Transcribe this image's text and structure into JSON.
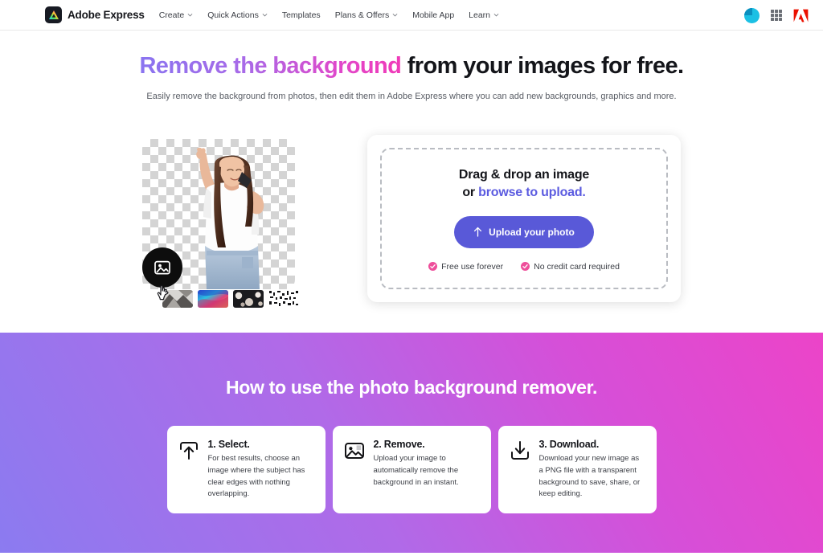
{
  "colors": {
    "accent_purple": "#5959d8",
    "link_purple": "#5b5be0",
    "pink_check": "#ee4f9b",
    "adobe_red": "#eb1000",
    "avatar_cyan": "#1bc0e4",
    "gradient_start": "#8b7bf0",
    "gradient_end": "#ec44c8"
  },
  "nav": {
    "brand": "Adobe Express",
    "brand_icon": "adobe-express-logo-icon",
    "links": [
      {
        "label": "Create",
        "has_caret": true
      },
      {
        "label": "Quick Actions",
        "has_caret": true
      },
      {
        "label": "Templates",
        "has_caret": false
      },
      {
        "label": "Plans & Offers",
        "has_caret": true
      },
      {
        "label": "Mobile App",
        "has_caret": false
      },
      {
        "label": "Learn",
        "has_caret": true
      }
    ],
    "right_icons": [
      "user-avatar",
      "apps-grid-icon",
      "adobe-logo-icon"
    ]
  },
  "hero": {
    "headline_gradient": "Remove the background",
    "headline_rest": " from your images for free.",
    "subheadline": "Easily remove the background from photos, then edit them in Adobe Express where you can add new backgrounds, graphics and more."
  },
  "preview": {
    "subject_alt": "woman-with-removed-background",
    "circle_button_icon": "image-icon",
    "cursor_icon": "hand-cursor-icon",
    "thumbnails": [
      {
        "name": "grayscale-geometric-background"
      },
      {
        "name": "colorful-abstract-background"
      },
      {
        "name": "dark-floral-background"
      },
      {
        "name": "black-white-noise-background"
      }
    ]
  },
  "upload": {
    "drop_line1": "Drag & drop an image",
    "drop_line2_prefix": "or ",
    "drop_line2_link": "browse to upload.",
    "button_label": "Upload your photo",
    "button_icon": "upload-arrow-icon",
    "perks": [
      {
        "label": "Free use forever",
        "icon": "check-circle-icon"
      },
      {
        "label": "No credit card required",
        "icon": "check-circle-icon"
      }
    ]
  },
  "howto": {
    "title": "How to use the photo background remover.",
    "steps": [
      {
        "icon": "upload-box-icon",
        "title": "1. Select.",
        "desc": "For best results, choose an image where the subject has clear edges with nothing overlapping."
      },
      {
        "icon": "image-icon",
        "title": "2. Remove.",
        "desc": "Upload your image to automatically remove the background in an instant."
      },
      {
        "icon": "download-icon",
        "title": "3. Download.",
        "desc": "Download your new image as a PNG file with a transparent background to save, share, or keep editing."
      }
    ]
  }
}
